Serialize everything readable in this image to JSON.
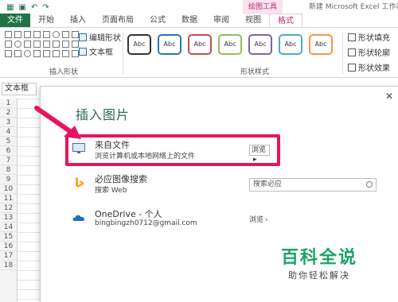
{
  "titlebar": {
    "context_title": "绘图工具",
    "window_title": "新建 Microsoft Excel 工作表..."
  },
  "tabs": [
    "文件",
    "开始",
    "插入",
    "页面布局",
    "公式",
    "数据",
    "审阅",
    "视图",
    "格式"
  ],
  "ribbon": {
    "edit_shape": "编辑形状",
    "text_box": "文本框",
    "insert_shapes_label": "插入形状",
    "shape_styles_label": "形状样式",
    "style_swatch_text": "Abc",
    "style_colors": [
      "#333333",
      "#2e75b6",
      "#c0504d",
      "#9bbb59",
      "#8064a2",
      "#4bacc6",
      "#f79646"
    ],
    "shape_fill": "形状填充",
    "shape_outline": "形状轮廓",
    "shape_effects": "形状效果"
  },
  "namebox": "文本框",
  "rows": [
    "1",
    "2",
    "3",
    "4",
    "5",
    "6",
    "7",
    "8",
    "9",
    "10",
    "11",
    "12",
    "13",
    "14",
    "15",
    "16",
    "17",
    "18"
  ],
  "dialog": {
    "title": "插入图片",
    "close_icon": "close-icon",
    "items": [
      {
        "name": "来自文件",
        "sub": "浏览计算机或本地网络上的文件",
        "action": "浏览",
        "icon": "computer-icon"
      },
      {
        "name": "必应图像搜索",
        "sub": "搜索 Web",
        "action": "搜索必应",
        "icon": "bing-icon"
      },
      {
        "name": "OneDrive - 个人",
        "sub": "bingbingzh0712@gmail.com",
        "action": "浏览",
        "icon": "cloud-icon"
      }
    ]
  },
  "watermark": {
    "main": "百科全说",
    "sub": "助你轻松解决"
  },
  "colors": {
    "excel_green": "#217346",
    "highlight_pink": "#e8135f",
    "context_pink": "#c0276f",
    "watermark_green": "#1aa36a"
  }
}
